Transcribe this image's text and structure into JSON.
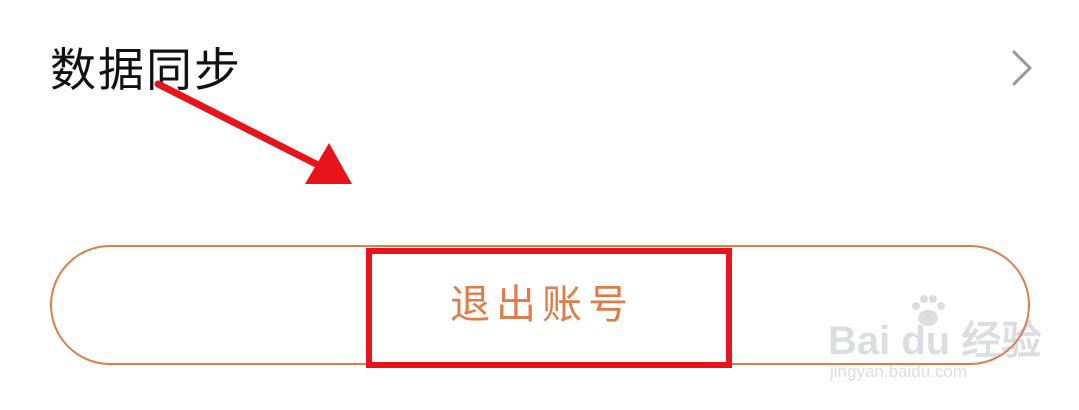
{
  "settings_row": {
    "label": "数据同步",
    "chevron_icon": "chevron-right-icon"
  },
  "logout": {
    "label": "退出账号"
  },
  "annotation": {
    "arrow_color": "#e8141b",
    "box_color": "#e8141b"
  },
  "colors": {
    "accent": "#e07b4a",
    "text": "#111111",
    "chevron": "#9a9a9a"
  },
  "watermark": {
    "brand": "Bai du 经验",
    "url": "jingyan.baidu.com"
  }
}
